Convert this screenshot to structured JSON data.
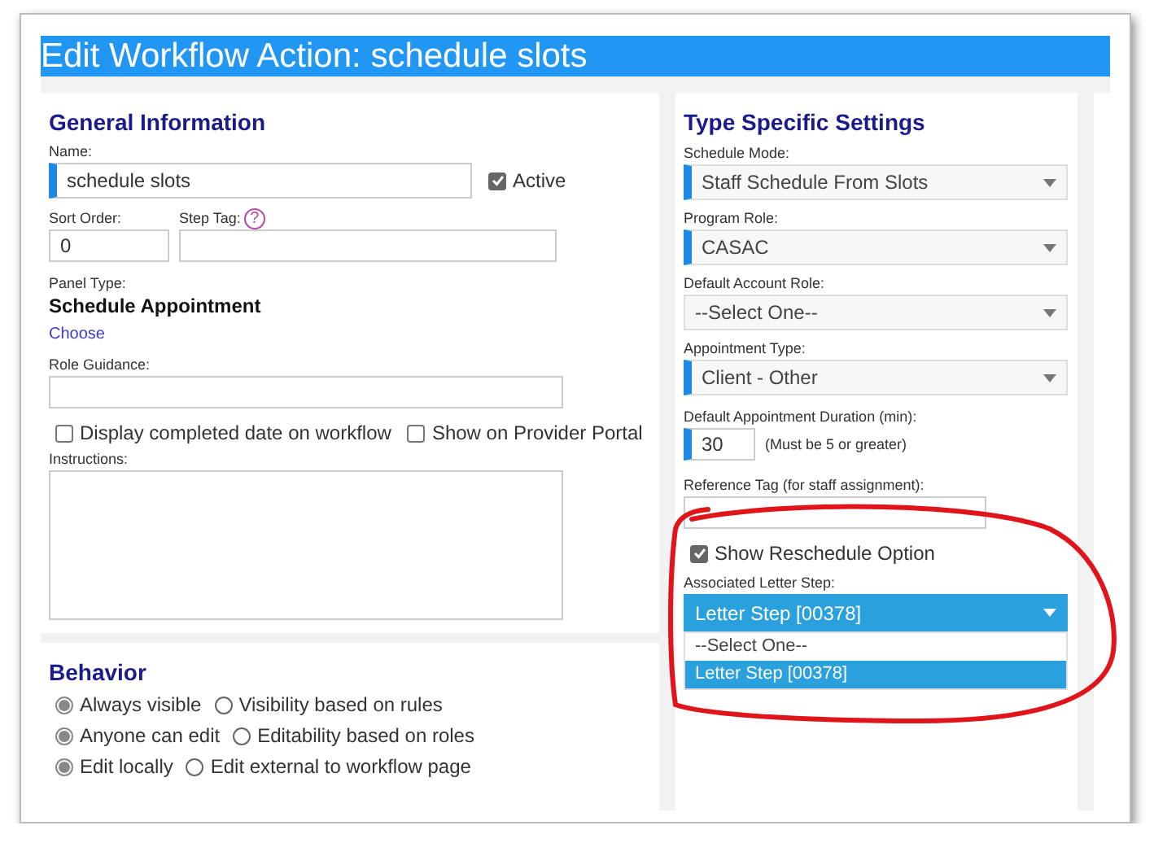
{
  "window": {
    "title": "Edit Workflow Action: schedule slots"
  },
  "general": {
    "heading": "General Information",
    "name": {
      "label": "Name:",
      "value": "schedule slots",
      "required": true
    },
    "active": {
      "label": "Active",
      "checked": true
    },
    "sort_order": {
      "label": "Sort Order:",
      "value": "0"
    },
    "step_tag": {
      "label": "Step Tag:",
      "help": "?"
    },
    "panel_type": {
      "label": "Panel Type:",
      "value": "Schedule Appointment",
      "link": "Choose"
    },
    "role_guidance": {
      "label": "Role Guidance:"
    },
    "checkboxes": [
      {
        "label": "Display completed date on workflow",
        "checked": false
      },
      {
        "label": "Show on Provider Portal",
        "checked": false
      }
    ],
    "instructions": {
      "label": "Instructions:"
    }
  },
  "behavior": {
    "heading": "Behavior",
    "radio_rows": [
      {
        "options": [
          {
            "label": "Always visible",
            "selected": true
          },
          {
            "label": "Visibility based on rules",
            "selected": false
          }
        ]
      },
      {
        "options": [
          {
            "label": "Anyone can edit",
            "selected": true
          },
          {
            "label": "Editability based on roles",
            "selected": false
          }
        ]
      },
      {
        "options": [
          {
            "label": "Edit locally",
            "selected": true
          },
          {
            "label": "Edit external to workflow page",
            "selected": false
          }
        ]
      }
    ]
  },
  "type_settings": {
    "heading": "Type Specific Settings",
    "selects": [
      {
        "label": "Schedule Mode:",
        "value": "Staff Schedule From Slots",
        "required": true
      },
      {
        "label": "Program Role:",
        "value": "CASAC",
        "required": true
      },
      {
        "label": "Default Account Role:",
        "value": "--Select One--",
        "required": false
      },
      {
        "label": "Appointment Type:",
        "value": "Client - Other",
        "required": true
      }
    ],
    "duration": {
      "label": "Default Appointment Duration (min):",
      "value": "30",
      "hint": "(Must be 5 or greater)",
      "required": true
    },
    "reference_tag": {
      "label": "Reference Tag (for staff assignment):"
    },
    "reschedule": {
      "label": "Show Reschedule Option",
      "checked": true
    },
    "letter_step": {
      "label": "Associated Letter Step:",
      "value": "Letter Step [00378]",
      "expanded": true,
      "options": [
        {
          "label": "--Select One--",
          "selected": false
        },
        {
          "label": "Letter Step [00378]",
          "selected": true
        }
      ]
    }
  }
}
